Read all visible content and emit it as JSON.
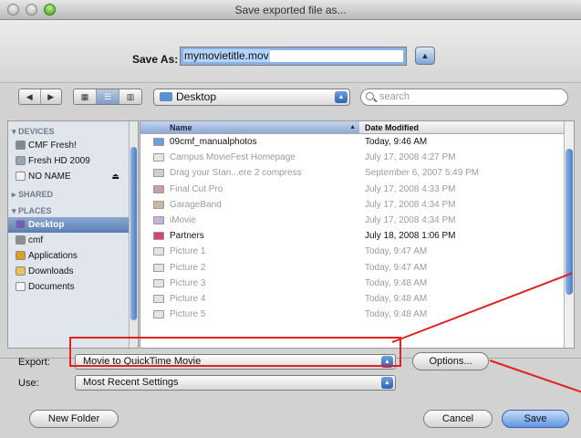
{
  "window": {
    "title": "Save exported file as..."
  },
  "save_as": {
    "label": "Save As:",
    "value": "mymovietitle.mov"
  },
  "expand_button": {
    "glyph": "▲"
  },
  "nav": {
    "back": "◀",
    "forward": "▶"
  },
  "view_modes": {
    "icon": "▦",
    "list": "☰",
    "column": "▥"
  },
  "location": {
    "value": "Desktop"
  },
  "search": {
    "placeholder": "search"
  },
  "sidebar": {
    "sections": [
      {
        "header": "DEVICES",
        "items": [
          {
            "label": "CMF Fresh!",
            "icon": "hard-drive-icon",
            "color": "#7f8a98"
          },
          {
            "label": "Fresh HD 2009",
            "icon": "hard-drive-icon",
            "color": "#9aa4b1"
          },
          {
            "label": "NO NAME",
            "icon": "removable-drive-icon",
            "color": "#f2f2f2"
          }
        ]
      },
      {
        "header": "SHARED",
        "items": []
      },
      {
        "header": "PLACES",
        "items": [
          {
            "label": "Desktop",
            "icon": "desktop-icon",
            "color": "#6b5fb8",
            "selected": true
          },
          {
            "label": "cmf",
            "icon": "home-icon",
            "color": "#8f8f8f"
          },
          {
            "label": "Applications",
            "icon": "applications-icon",
            "color": "#d9a21c"
          },
          {
            "label": "Downloads",
            "icon": "downloads-folder-icon",
            "color": "#e9c25b"
          },
          {
            "label": "Documents",
            "icon": "documents-icon",
            "color": "#f4f4f4"
          }
        ]
      }
    ]
  },
  "file_list": {
    "headers": {
      "name": "Name",
      "date": "Date Modified"
    },
    "rows": [
      {
        "name": "09cmf_manualphotos",
        "date": "Today, 9:46 AM",
        "dim": false,
        "icon": "folder-icon",
        "color": "#6a9ee0"
      },
      {
        "name": "Campus MovieFest Homepage",
        "date": "July 17, 2008 4:27 PM",
        "dim": true,
        "icon": "webloc-icon",
        "color": "#e8e8e8"
      },
      {
        "name": "Drag your Stan...ere 2 compress",
        "date": "September 6, 2007 5:49 PM",
        "dim": true,
        "icon": "document-icon",
        "color": "#d0d0d0"
      },
      {
        "name": "Final Cut Pro",
        "date": "July 17, 2008 4:33 PM",
        "dim": true,
        "icon": "final-cut-icon",
        "color": "#c9a0a0"
      },
      {
        "name": "GarageBand",
        "date": "July 17, 2008 4:34 PM",
        "dim": true,
        "icon": "garageband-icon",
        "color": "#c8b9a0"
      },
      {
        "name": "iMovie",
        "date": "July 17, 2008 4:34 PM",
        "dim": true,
        "icon": "imovie-icon",
        "color": "#c8b0d8"
      },
      {
        "name": "Partners",
        "date": "July 18, 2008 1:06 PM",
        "dim": false,
        "icon": "partners-icon",
        "color": "#d8407a"
      },
      {
        "name": "Picture 1",
        "date": "Today, 9:47 AM",
        "dim": true,
        "icon": "picture-icon",
        "color": "#e4e4e4"
      },
      {
        "name": "Picture 2",
        "date": "Today, 9:47 AM",
        "dim": true,
        "icon": "picture-icon",
        "color": "#e4e4e4"
      },
      {
        "name": "Picture 3",
        "date": "Today, 9:48 AM",
        "dim": true,
        "icon": "picture-icon",
        "color": "#e4e4e4"
      },
      {
        "name": "Picture 4",
        "date": "Today, 9:48 AM",
        "dim": true,
        "icon": "picture-icon",
        "color": "#e4e4e4"
      },
      {
        "name": "Picture 5",
        "date": "Today, 9:48 AM",
        "dim": true,
        "icon": "picture-icon",
        "color": "#e4e4e4"
      }
    ]
  },
  "export": {
    "label": "Export:",
    "value": "Movie to QuickTime Movie"
  },
  "use": {
    "label": "Use:",
    "value": "Most Recent Settings"
  },
  "buttons": {
    "options": "Options...",
    "new_folder": "New Folder",
    "cancel": "Cancel",
    "save": "Save"
  },
  "annotation": {
    "color": "#e02222"
  }
}
